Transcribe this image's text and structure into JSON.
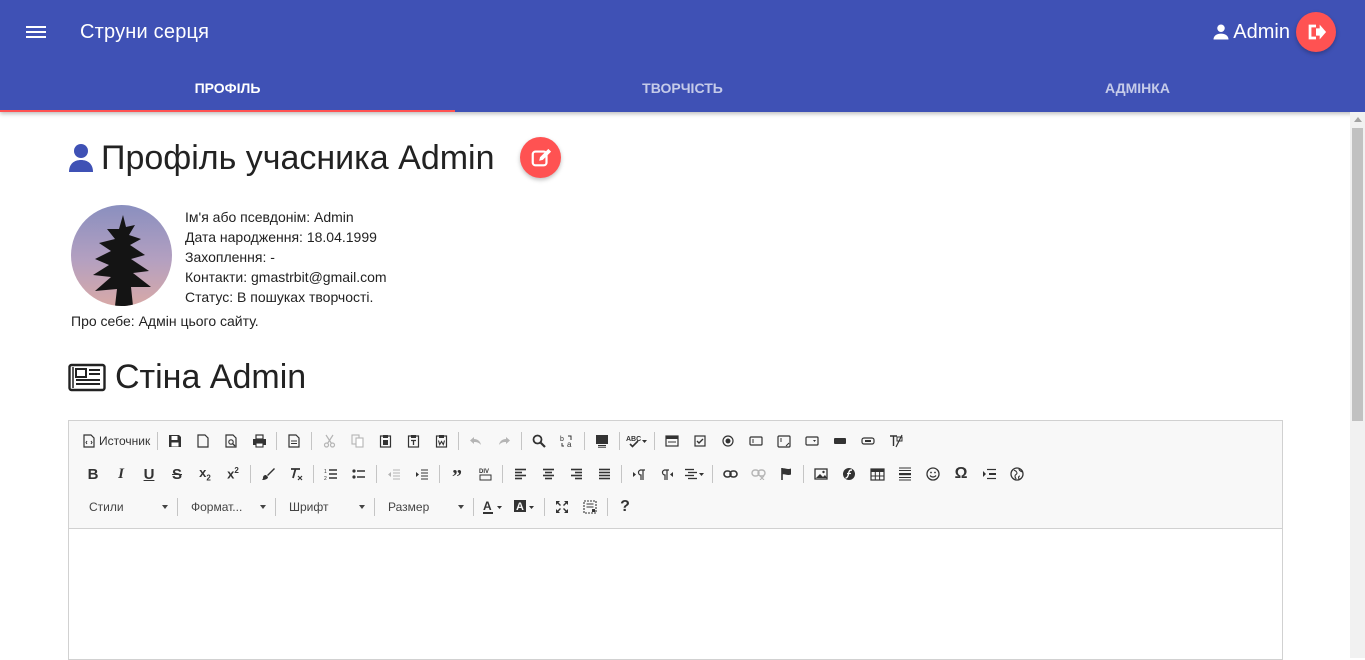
{
  "app": {
    "title": "Струни серця",
    "user_name": "Admin",
    "colors": {
      "primary": "#3f51b5",
      "accent": "#ff5252"
    }
  },
  "tabs": [
    {
      "label": "Профіль",
      "active": true
    },
    {
      "label": "Творчість",
      "active": false
    },
    {
      "label": "Адмінка",
      "active": false
    }
  ],
  "profile": {
    "heading": "Профіль учасника Admin",
    "fields": [
      "Ім'я або псевдонім: Admin",
      "Дата народження: 18.04.1999",
      "Захоплення: -",
      "Контакти: gmastrbit@gmail.com",
      "Статус: В пошуках творчості."
    ],
    "about": "Про себе: Адмін цього сайту."
  },
  "wall": {
    "heading": "Стіна Admin"
  },
  "editor": {
    "source_label": "Источник",
    "combos": {
      "styles": "Стили",
      "format": "Формат...",
      "font": "Шрифт",
      "size": "Размер"
    },
    "content": ""
  }
}
